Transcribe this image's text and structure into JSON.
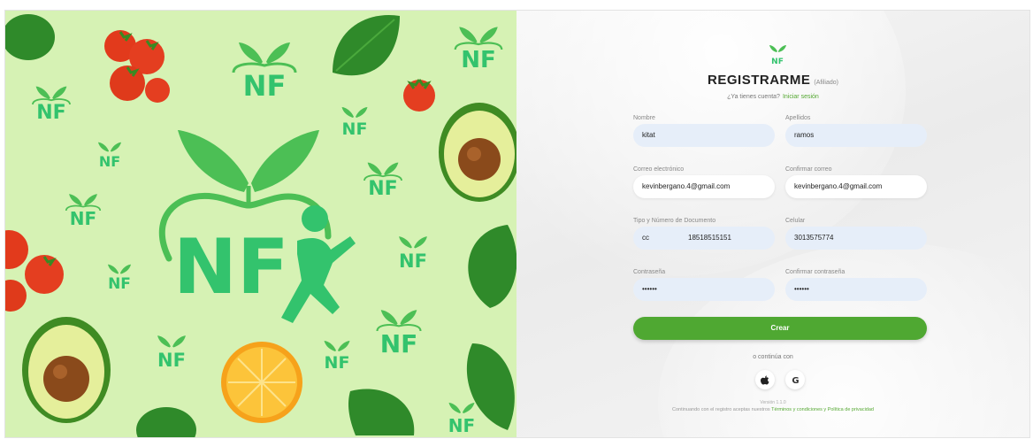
{
  "brand": {
    "logo_text": "NF",
    "logo_color": "#33c36d",
    "leaf_color": "#4cbf55",
    "panel_bg": "#d6f2b4"
  },
  "form": {
    "title": "REGISTRARME",
    "title_suffix": "(Afiliado)",
    "have_account_text": "¿Ya tienes cuenta?",
    "login_link": "Iniciar sesión",
    "fields": {
      "first_name": {
        "label": "Nombre",
        "value": "kitat"
      },
      "last_name": {
        "label": "Apellidos",
        "value": "ramos"
      },
      "email": {
        "label": "Correo electrónico",
        "value": "kevinbergano.4@gmail.com"
      },
      "confirm_email": {
        "label": "Confirmar correo",
        "value": "kevinbergano.4@gmail.com"
      },
      "document": {
        "label": "Tipo y Número de Documento",
        "type_value": "cc",
        "number_value": "18518515151"
      },
      "phone": {
        "label": "Celular",
        "value": "3013575774"
      },
      "password": {
        "label": "Contraseña",
        "value": "••••••"
      },
      "confirm_password": {
        "label": "Confirmar contraseña",
        "value": "••••••"
      }
    },
    "create_button": "Crear",
    "or_continue": "o continúa con",
    "social": [
      "apple-icon",
      "google-icon"
    ],
    "version": "Versión 1.1.0",
    "terms_prefix": "Continuando con el registro aceptas nuestros",
    "terms_link": "Términos y condiciones y Política de privacidad",
    "accent": "#4fa832",
    "input_bg": "#e6eef9"
  }
}
